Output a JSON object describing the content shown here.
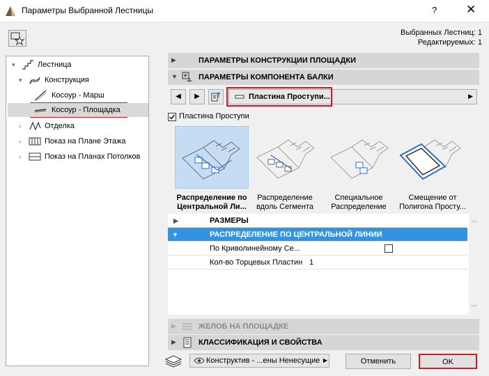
{
  "window": {
    "title": "Параметры Выбранной Лестницы",
    "help": "?",
    "close": "✕"
  },
  "selection_info": {
    "selected": "Выбранных Лестниц: 1",
    "editable": "Редактируемых: 1"
  },
  "tree": {
    "items": [
      {
        "label": "Лестница"
      },
      {
        "label": "Конструкция"
      },
      {
        "label": "Косоур - Марш"
      },
      {
        "label": "Косоур - Площадка"
      },
      {
        "label": "Отделка"
      },
      {
        "label": "Показ на Плане Этажа"
      },
      {
        "label": "Показ на Планах Потолков"
      }
    ]
  },
  "sections": {
    "landing_params": "ПАРАМЕТРЫ КОНСТРУКЦИИ ПЛОЩАДКИ",
    "beam_params": "ПАРАМЕТРЫ КОМПОНЕНТА БАЛКИ",
    "gutter": "ЖЕЛОБ НА ПЛОЩАДКЕ",
    "classification": "КЛАССИФИКАЦИЯ И СВОЙСТВА"
  },
  "component": {
    "dropdown_value": "Пластина Проступи...",
    "checkbox_label": "Пластина Проступи",
    "checked": true
  },
  "distribution": {
    "options": [
      {
        "line1": "Распределение по",
        "line2": "Центральной Ли..."
      },
      {
        "line1": "Распределение",
        "line2": "вдоль Сегмента"
      },
      {
        "line1": "Специальное",
        "line2": "Распределение"
      },
      {
        "line1": "Смещение от",
        "line2": "Полигона Просту..."
      }
    ]
  },
  "grid": {
    "sizes_header": "РАЗМЕРЫ",
    "group_header": "РАСПРЕДЕЛЕНИЕ ПО ЦЕНТРАЛЬНОЙ ЛИНИИ",
    "rows": [
      {
        "label": "По Криволинейному Се...",
        "value": ""
      },
      {
        "label": "Кол-во Торцевых Пластин",
        "value": "1"
      }
    ]
  },
  "footer": {
    "layer_value": "Конструктив - ...ены Ненесущие",
    "cancel": "Отменить",
    "ok": "OK"
  }
}
